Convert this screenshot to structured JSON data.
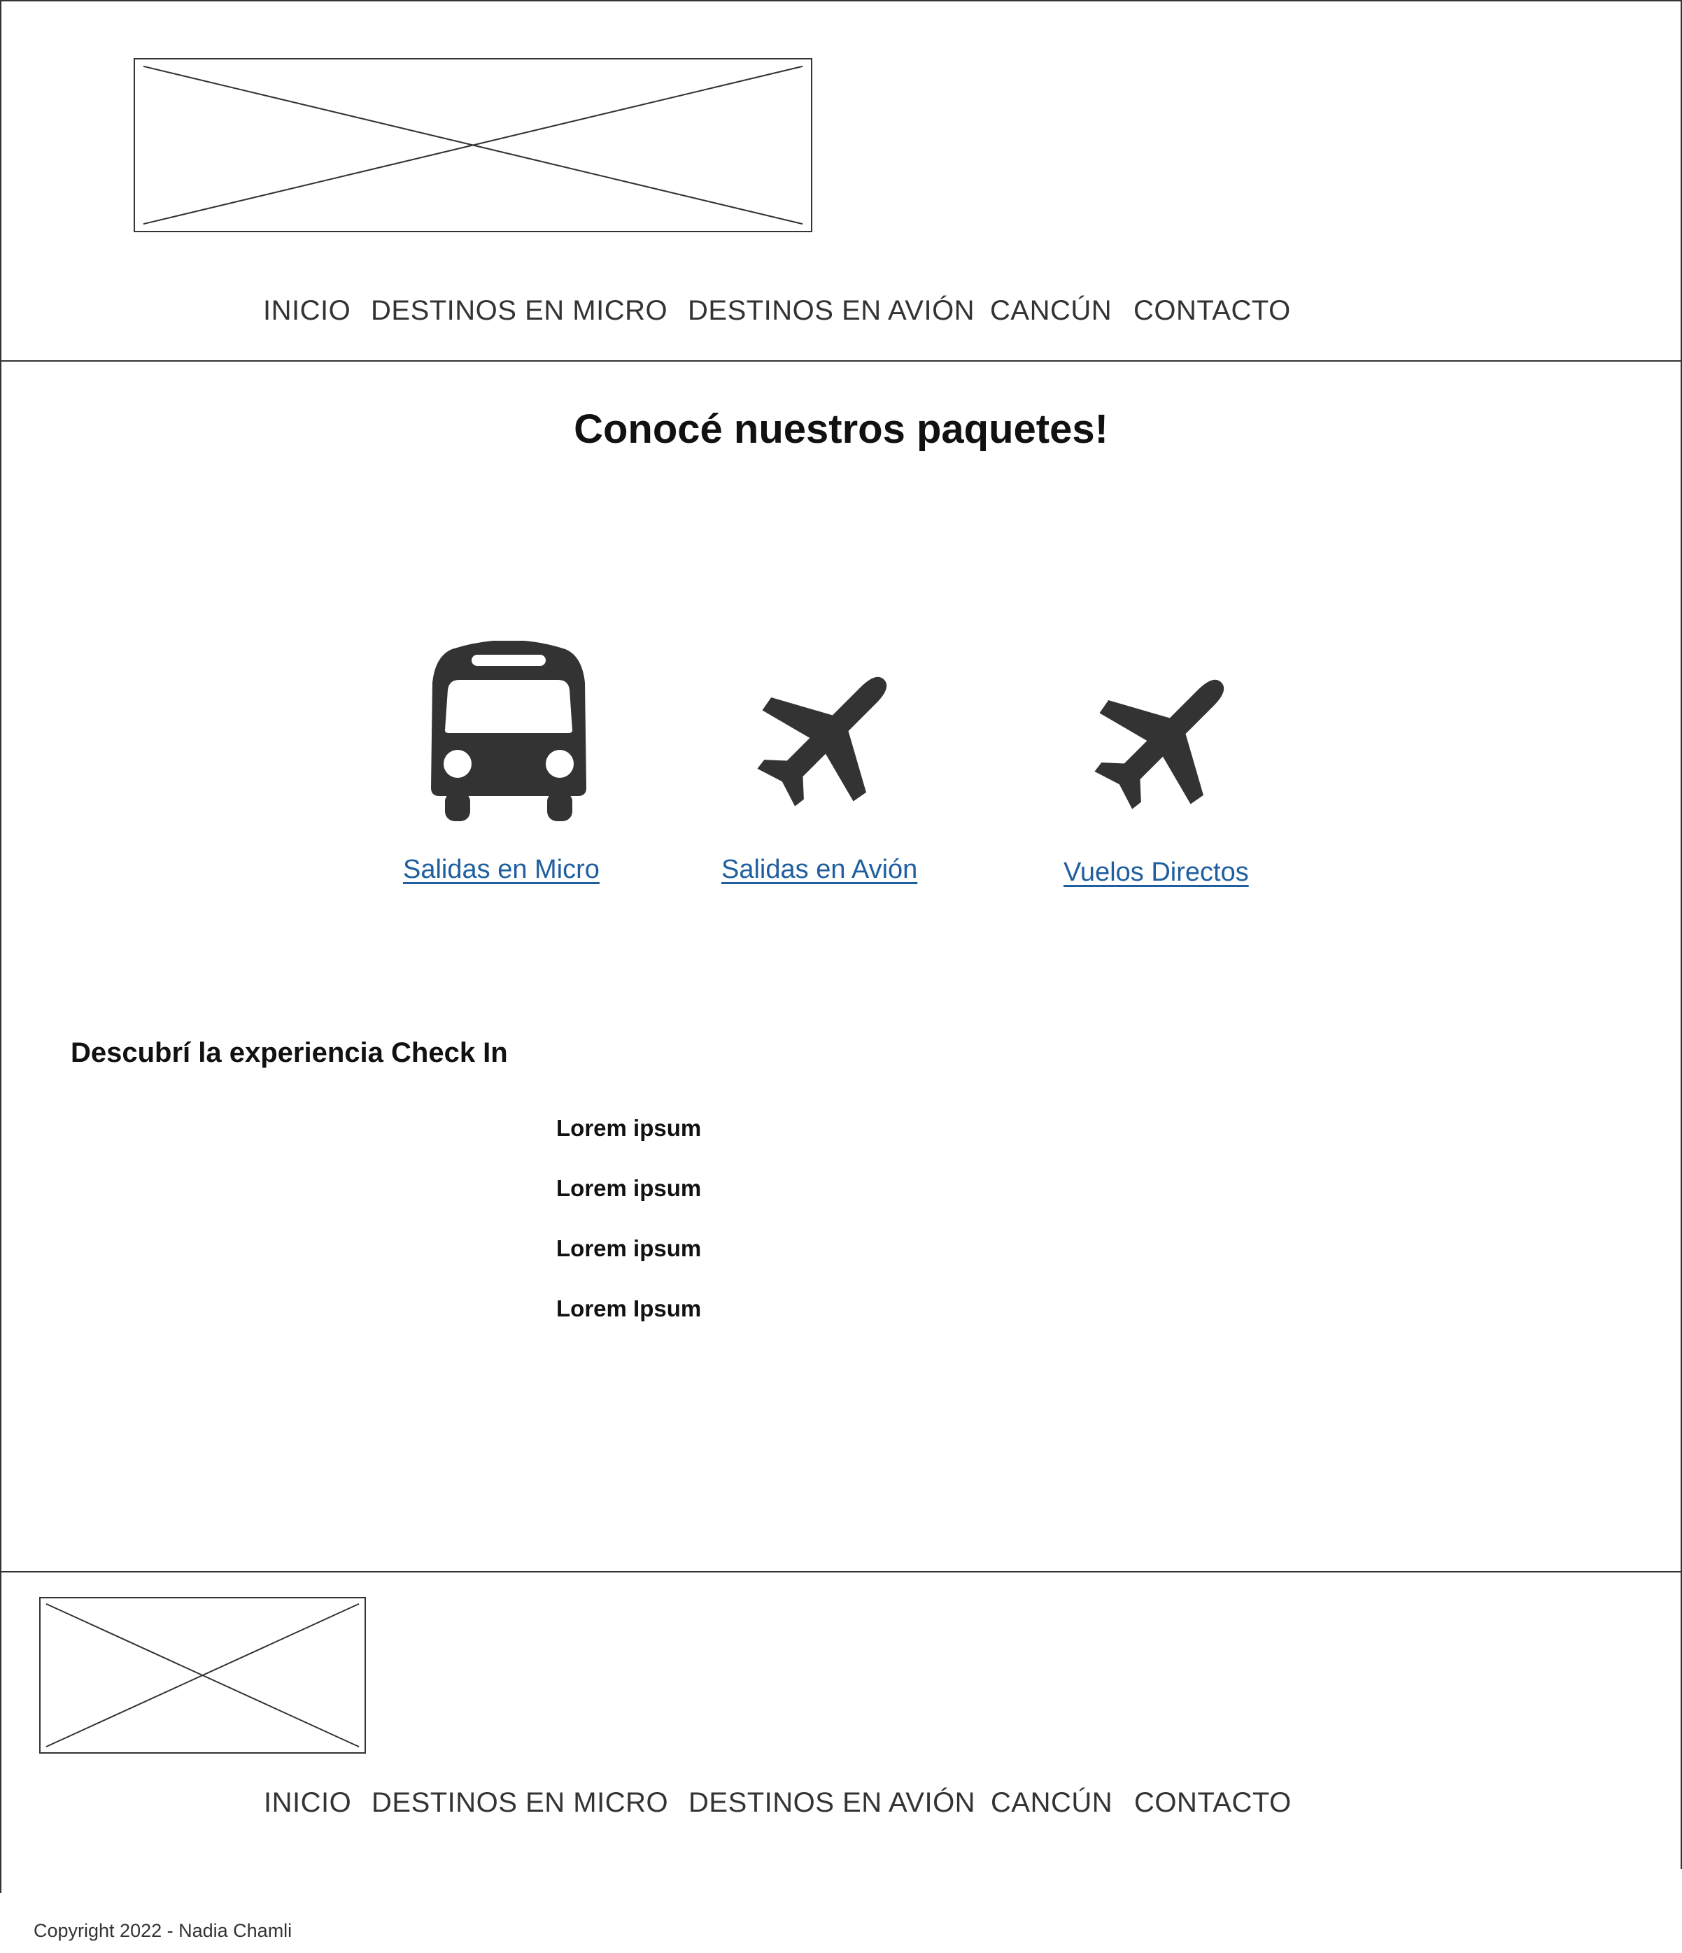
{
  "header": {
    "logo": "logo-placeholder",
    "nav": [
      "INICIO",
      "DESTINOS EN MICRO",
      "DESTINOS EN AVIÓN",
      "CANCÚN",
      "CONTACTO"
    ]
  },
  "main": {
    "title": "Conocé nuestros paquetes!",
    "packages": [
      {
        "icon": "bus-icon",
        "label": "Salidas en Micro"
      },
      {
        "icon": "airplane-icon",
        "label": "Salidas en Avión"
      },
      {
        "icon": "airplane-icon",
        "label": "Vuelos Directos"
      }
    ],
    "experience_title": "Descubrí la experiencia Check In",
    "experience_items": [
      "Lorem ipsum",
      "Lorem ipsum",
      "Lorem ipsum",
      "Lorem Ipsum"
    ]
  },
  "footer": {
    "logo": "logo-placeholder",
    "nav": [
      "INICIO",
      "DESTINOS EN MICRO",
      "DESTINOS EN AVIÓN",
      "CANCÚN",
      "CONTACTO"
    ],
    "copyright": "Copyright 2022 - Nadia Chamli"
  },
  "colors": {
    "link": "#1f5f9f",
    "icon": "#333333",
    "lines": "#333333"
  }
}
